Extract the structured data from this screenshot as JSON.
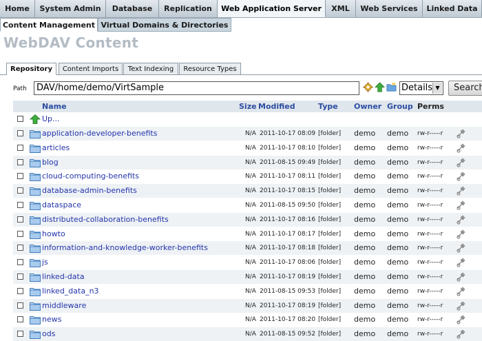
{
  "top_tabs": [
    "Home",
    "System Admin",
    "Database",
    "Replication",
    "Web Application Server",
    "XML",
    "Web Services",
    "Linked Data"
  ],
  "top_tab_active": "Web Application Server",
  "sub_tabs": [
    "Content Management",
    "Virtual Domains & Directories"
  ],
  "page_title": "WebDAV Content",
  "content_tabs": [
    "Repository",
    "Content Imports",
    "Text Indexing",
    "Resource Types"
  ],
  "path": {
    "label": "Path",
    "value": "DAV/home/demo/VirtSample"
  },
  "view_select": {
    "value": "Details"
  },
  "search_button": "Search",
  "columns": {
    "name": "Name",
    "size": "Size",
    "modified": "Modified",
    "type": "Type",
    "owner": "Owner",
    "group": "Group",
    "perms": "Perms"
  },
  "up_label": "Up...",
  "rows": [
    {
      "name": "application-developer-benefits",
      "size": "N/A",
      "modified": "2011-10-17 08:09",
      "type": "[folder]",
      "owner": "demo",
      "group": "demo",
      "perms": "rw-r-----r"
    },
    {
      "name": "articles",
      "size": "N/A",
      "modified": "2011-10-17 08:10",
      "type": "[folder]",
      "owner": "demo",
      "group": "demo",
      "perms": "rw-r-----r"
    },
    {
      "name": "blog",
      "size": "N/A",
      "modified": "2011-08-15 09:49",
      "type": "[folder]",
      "owner": "demo",
      "group": "demo",
      "perms": "rw-r-----r"
    },
    {
      "name": "cloud-computing-benefits",
      "size": "N/A",
      "modified": "2011-10-17 08:11",
      "type": "[folder]",
      "owner": "demo",
      "group": "demo",
      "perms": "rw-r-----r"
    },
    {
      "name": "database-admin-benefits",
      "size": "N/A",
      "modified": "2011-10-17 08:15",
      "type": "[folder]",
      "owner": "demo",
      "group": "demo",
      "perms": "rw-r-----r"
    },
    {
      "name": "dataspace",
      "size": "N/A",
      "modified": "2011-08-15 09:50",
      "type": "[folder]",
      "owner": "demo",
      "group": "demo",
      "perms": "rw-r-----r"
    },
    {
      "name": "distributed-collaboration-benefits",
      "size": "N/A",
      "modified": "2011-10-17 08:16",
      "type": "[folder]",
      "owner": "demo",
      "group": "demo",
      "perms": "rw-r-----r"
    },
    {
      "name": "howto",
      "size": "N/A",
      "modified": "2011-10-17 08:17",
      "type": "[folder]",
      "owner": "demo",
      "group": "demo",
      "perms": "rw-r-----r"
    },
    {
      "name": "information-and-knowledge-worker-benefits",
      "size": "N/A",
      "modified": "2011-10-17 08:18",
      "type": "[folder]",
      "owner": "demo",
      "group": "demo",
      "perms": "rw-r-----r"
    },
    {
      "name": "js",
      "size": "N/A",
      "modified": "2011-10-17 08:06",
      "type": "[folder]",
      "owner": "demo",
      "group": "demo",
      "perms": "rw-r-----r"
    },
    {
      "name": "linked-data",
      "size": "N/A",
      "modified": "2011-10-17 08:19",
      "type": "[folder]",
      "owner": "demo",
      "group": "demo",
      "perms": "rw-r-----r"
    },
    {
      "name": "linked_data_n3",
      "size": "N/A",
      "modified": "2011-08-15 09:53",
      "type": "[folder]",
      "owner": "demo",
      "group": "demo",
      "perms": "rw-r-----r"
    },
    {
      "name": "middleware",
      "size": "N/A",
      "modified": "2011-10-17 08:19",
      "type": "[folder]",
      "owner": "demo",
      "group": "demo",
      "perms": "rw-r-----r"
    },
    {
      "name": "news",
      "size": "N/A",
      "modified": "2011-10-17 08:20",
      "type": "[folder]",
      "owner": "demo",
      "group": "demo",
      "perms": "rw-r-----r"
    },
    {
      "name": "ods",
      "size": "N/A",
      "modified": "2011-08-15 09:52",
      "type": "[folder]",
      "owner": "demo",
      "group": "demo",
      "perms": "rw-r-----r"
    }
  ],
  "icons": {
    "folder": "folder-icon",
    "up": "up-arrow-icon",
    "action": "properties-icon",
    "settings": "gear-icon"
  },
  "colors": {
    "link": "#2233aa",
    "header_link": "#2c4ca0",
    "title": "#b3bcc4",
    "folder": "#4a90d9",
    "up_arrow": "#2e9c2e"
  }
}
